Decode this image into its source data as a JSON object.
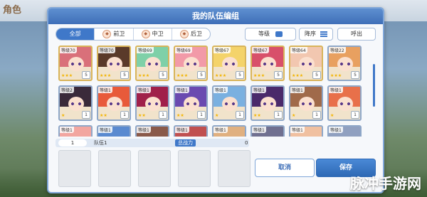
{
  "dialog": {
    "title": "我的队伍编组"
  },
  "bg": {
    "logo": "角色"
  },
  "filters": {
    "tabs": [
      {
        "label": "全部",
        "active": true
      },
      {
        "label": "前卫",
        "icon": "vanguard-icon"
      },
      {
        "label": "中卫",
        "icon": "midguard-icon"
      },
      {
        "label": "后卫",
        "icon": "rearguard-icon"
      }
    ],
    "sort_label": "等级",
    "order_label": "降序",
    "call_label": "呼出"
  },
  "roster": [
    {
      "level": "等级70",
      "hair": "#d9707a",
      "stars": "★★★",
      "rank": "5",
      "gold": true
    },
    {
      "level": "等级70",
      "hair": "#5a3a2a",
      "stars": "★★★",
      "rank": "5",
      "gold": true
    },
    {
      "level": "等级69",
      "hair": "#7fd0a8",
      "stars": "★★★",
      "rank": "5",
      "gold": true
    },
    {
      "level": "等级69",
      "hair": "#f29aa8",
      "stars": "★★★",
      "rank": "5",
      "gold": true
    },
    {
      "level": "等级67",
      "hair": "#f4d36a",
      "stars": "★★★",
      "rank": "5",
      "gold": true
    },
    {
      "level": "等级67",
      "hair": "#d8506a",
      "stars": "★★★",
      "rank": "5",
      "gold": true
    },
    {
      "level": "等级64",
      "hair": "#f2c7b0",
      "stars": "★★★",
      "rank": "5",
      "gold": true
    },
    {
      "level": "等级22",
      "hair": "#e8a060",
      "stars": "★★★",
      "rank": "5",
      "gold": false
    },
    {
      "level": "等级2",
      "hair": "#3a2a3a",
      "stars": "★",
      "rank": "1",
      "gold": false
    },
    {
      "level": "等级1",
      "hair": "#e85a3a",
      "stars": "★★",
      "rank": "1",
      "gold": false
    },
    {
      "level": "等级1",
      "hair": "#a0204a",
      "stars": "★★",
      "rank": "1",
      "gold": false
    },
    {
      "level": "等级1",
      "hair": "#6a4ab0",
      "stars": "★★",
      "rank": "1",
      "gold": false
    },
    {
      "level": "等级1",
      "hair": "#7ab0e0",
      "stars": "★",
      "rank": "1",
      "gold": false
    },
    {
      "level": "等级1",
      "hair": "#4a2a6a",
      "stars": "★★",
      "rank": "1",
      "gold": false
    },
    {
      "level": "等级1",
      "hair": "#a06a4a",
      "stars": "★",
      "rank": "1",
      "gold": false
    },
    {
      "level": "等级1",
      "hair": "#e8704a",
      "stars": "★",
      "rank": "1",
      "gold": false
    },
    {
      "level": "等级1",
      "hair": "#f2a6a0",
      "stars": "",
      "rank": "",
      "gold": false
    },
    {
      "level": "等级1",
      "hair": "#5a8ad0",
      "stars": "",
      "rank": "",
      "gold": false
    },
    {
      "level": "等级1",
      "hair": "#8a5a4a",
      "stars": "",
      "rank": "",
      "gold": false
    },
    {
      "level": "等级1",
      "hair": "#c05050",
      "stars": "",
      "rank": "",
      "gold": false
    },
    {
      "level": "等级1",
      "hair": "#e0b080",
      "stars": "",
      "rank": "",
      "gold": false
    },
    {
      "level": "等级1",
      "hair": "#707090",
      "stars": "",
      "rank": "",
      "gold": false
    },
    {
      "level": "等级1",
      "hair": "#f0c0a0",
      "stars": "",
      "rank": "",
      "gold": false
    },
    {
      "level": "等级1",
      "hair": "#90a0c0",
      "stars": "",
      "rank": "",
      "gold": false
    }
  ],
  "team": {
    "number": "1",
    "name": "队伍1",
    "power_label": "总战力",
    "power_value": "0"
  },
  "buttons": {
    "cancel": "取消",
    "save": "保存"
  },
  "watermark": "脉冲手游网"
}
